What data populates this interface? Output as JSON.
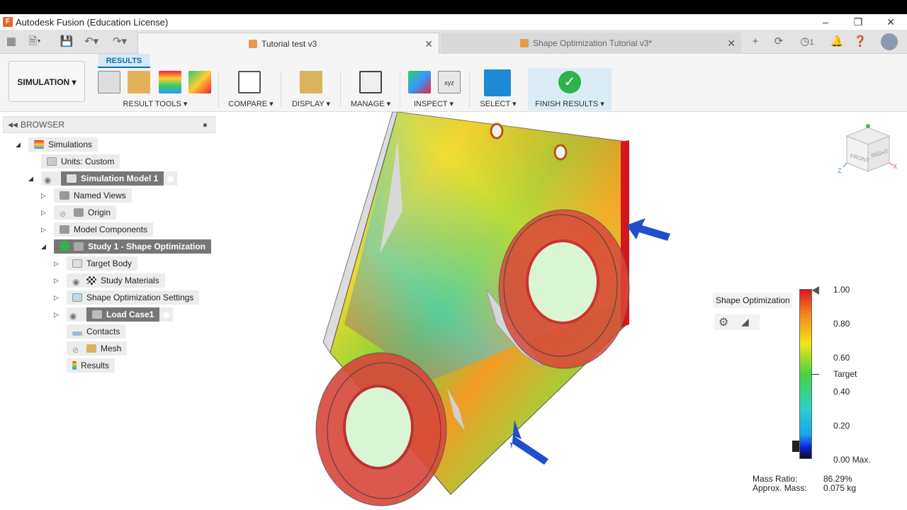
{
  "app": {
    "title": "Autodesk Fusion (Education License)"
  },
  "tabs": [
    {
      "label": "Tutorial test v3",
      "active": true
    },
    {
      "label": "Shape Optimization Tutorial v3*",
      "active": false
    }
  ],
  "quick_access": {
    "notification_count": "1"
  },
  "ribbon": {
    "workspace": "SIMULATION",
    "active_tab": "RESULTS",
    "groups": [
      {
        "label": "RESULT TOOLS"
      },
      {
        "label": "COMPARE"
      },
      {
        "label": "DISPLAY"
      },
      {
        "label": "MANAGE"
      },
      {
        "label": "INSPECT"
      },
      {
        "label": "SELECT"
      },
      {
        "label": "FINISH RESULTS"
      }
    ]
  },
  "browser": {
    "title": "BROWSER",
    "items": [
      {
        "label": "Simulations"
      },
      {
        "label": "Units: Custom"
      },
      {
        "label": "Simulation Model 1"
      },
      {
        "label": "Named Views"
      },
      {
        "label": "Origin"
      },
      {
        "label": "Model Components"
      },
      {
        "label": "Study 1 - Shape Optimization"
      },
      {
        "label": "Target Body"
      },
      {
        "label": "Study Materials"
      },
      {
        "label": "Shape Optimization Settings"
      },
      {
        "label": "Load Case1"
      },
      {
        "label": "Contacts"
      },
      {
        "label": "Mesh"
      },
      {
        "label": "Results"
      }
    ]
  },
  "viewcube": {
    "front": "FRONT",
    "right": "RIGHT",
    "axis_x": "X",
    "axis_z": "Z"
  },
  "legend": {
    "title": "Shape Optimization",
    "ticks": [
      "1.00",
      "0.80",
      "0.60",
      "0.40",
      "0.20",
      "0.00 Max."
    ],
    "target_label": "Target",
    "colors": {
      "max": "#e0141c",
      "mid": "#47d33e",
      "min": "#0b1bd6"
    }
  },
  "stats": {
    "mass_ratio_label": "Mass Ratio:",
    "mass_ratio_value": "86.29%",
    "approx_mass_label": "Approx. Mass:",
    "approx_mass_value": "0.075 kg"
  }
}
